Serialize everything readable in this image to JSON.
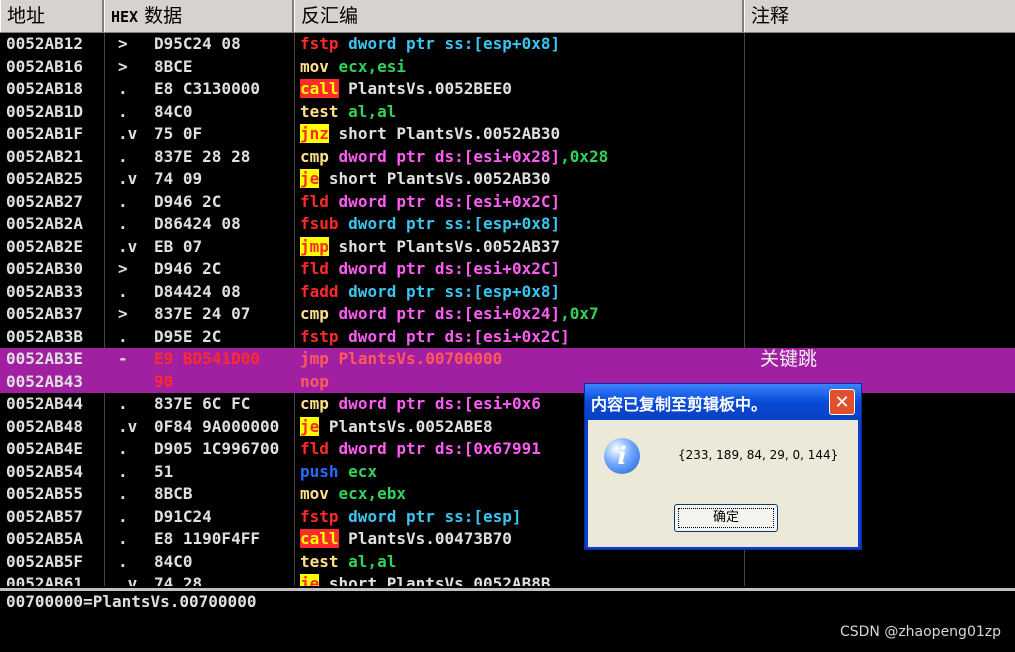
{
  "header": {
    "address": "地址",
    "hex_prefix": "HEX",
    "hex_label": "数据",
    "disasm": "反汇编",
    "comment": "注释"
  },
  "rows": [
    {
      "addr": "0052AB12",
      "mark": ">",
      "hex": "D95C24 08",
      "mn": "fstp",
      "mc": "m-fpu",
      "ops": [
        [
          "dword ptr ss:[esp+0x8]",
          "o1"
        ]
      ]
    },
    {
      "addr": "0052AB16",
      "mark": ">",
      "hex": "8BCE",
      "mn": "mov",
      "mc": "m-mov",
      "ops": [
        [
          "ecx,esi",
          "o4"
        ]
      ]
    },
    {
      "addr": "0052AB18",
      "mark": ".",
      "hex": "E8 C3130000",
      "mn": "call",
      "mc": "m-call",
      "ops": [
        [
          "PlantsVs.0052BEE0",
          "o3"
        ]
      ]
    },
    {
      "addr": "0052AB1D",
      "mark": ".",
      "hex": "84C0",
      "mn": "test",
      "mc": "m-test",
      "ops": [
        [
          "al,al",
          "o4"
        ]
      ]
    },
    {
      "addr": "0052AB1F",
      "mark": ".v",
      "hex": "75 0F",
      "mn": "jnz",
      "mc": "m-jcc",
      "ops": [
        [
          "short PlantsVs.0052AB30",
          "o3"
        ]
      ]
    },
    {
      "addr": "0052AB21",
      "mark": ".",
      "hex": "837E 28 28",
      "mn": "cmp",
      "mc": "m-mov",
      "ops": [
        [
          "dword ptr ds:[esi+0x28]",
          "o2"
        ],
        [
          ",0x28",
          "o4"
        ]
      ]
    },
    {
      "addr": "0052AB25",
      "mark": ".v",
      "hex": "74 09",
      "mn": "je",
      "mc": "m-jcc",
      "ops": [
        [
          "short PlantsVs.0052AB30",
          "o3"
        ]
      ]
    },
    {
      "addr": "0052AB27",
      "mark": ".",
      "hex": "D946 2C",
      "mn": "fld",
      "mc": "m-fpu",
      "ops": [
        [
          "dword ptr ds:[esi+0x2C]",
          "o2"
        ]
      ]
    },
    {
      "addr": "0052AB2A",
      "mark": ".",
      "hex": "D86424 08",
      "mn": "fsub",
      "mc": "m-fpu",
      "ops": [
        [
          "dword ptr ss:[esp+0x8]",
          "o1"
        ]
      ]
    },
    {
      "addr": "0052AB2E",
      "mark": ".v",
      "hex": "EB 07",
      "mn": "jmp",
      "mc": "m-jcc",
      "ops": [
        [
          "short PlantsVs.0052AB37",
          "o3"
        ]
      ]
    },
    {
      "addr": "0052AB30",
      "mark": ">",
      "hex": "D946 2C",
      "mn": "fld",
      "mc": "m-fpu",
      "ops": [
        [
          "dword ptr ds:[esi+0x2C]",
          "o2"
        ]
      ]
    },
    {
      "addr": "0052AB33",
      "mark": ".",
      "hex": "D84424 08",
      "mn": "fadd",
      "mc": "m-fpu",
      "ops": [
        [
          "dword ptr ss:[esp+0x8]",
          "o1"
        ]
      ]
    },
    {
      "addr": "0052AB37",
      "mark": ">",
      "hex": "837E 24 07",
      "mn": "cmp",
      "mc": "m-mov",
      "ops": [
        [
          "dword ptr ds:[esi+0x24]",
          "o2"
        ],
        [
          ",0x7",
          "o4"
        ]
      ]
    },
    {
      "addr": "0052AB3B",
      "mark": ".",
      "hex": "D95E 2C",
      "mn": "fstp",
      "mc": "m-fpu",
      "ops": [
        [
          "dword ptr ds:[esi+0x2C]",
          "o2"
        ]
      ]
    },
    {
      "addr": "0052AB3E",
      "mark": "-",
      "hex": "E9 BD541D00",
      "mn": "jmp",
      "mc": "m-jcc",
      "ops": [
        [
          "PlantsVs.00700000",
          "o3"
        ]
      ],
      "sel": true,
      "comment": "关键跳"
    },
    {
      "addr": "0052AB43",
      "mark": "",
      "hex": "90",
      "mn": "nop",
      "mc": "m-mov",
      "ops": [],
      "sel": true
    },
    {
      "addr": "0052AB44",
      "mark": ".",
      "hex": "837E 6C FC",
      "mn": "cmp",
      "mc": "m-mov",
      "ops": [
        [
          "dword ptr ds:[esi+0x6",
          "o2"
        ]
      ]
    },
    {
      "addr": "0052AB48",
      "mark": ".v",
      "hex": "0F84 9A000000",
      "mn": "je",
      "mc": "m-jcc",
      "ops": [
        [
          "PlantsVs.0052ABE8",
          "o3"
        ]
      ]
    },
    {
      "addr": "0052AB4E",
      "mark": ".",
      "hex": "D905 1C996700",
      "mn": "fld",
      "mc": "m-fpu",
      "ops": [
        [
          "dword ptr ds:[0x67991",
          "o2"
        ]
      ]
    },
    {
      "addr": "0052AB54",
      "mark": ".",
      "hex": "51",
      "mn": "push",
      "mc": "m-push",
      "ops": [
        [
          "ecx",
          "o4"
        ]
      ]
    },
    {
      "addr": "0052AB55",
      "mark": ".",
      "hex": "8BCB",
      "mn": "mov",
      "mc": "m-mov",
      "ops": [
        [
          "ecx,ebx",
          "o4"
        ]
      ]
    },
    {
      "addr": "0052AB57",
      "mark": ".",
      "hex": "D91C24",
      "mn": "fstp",
      "mc": "m-fpu",
      "ops": [
        [
          "dword ptr ss:[esp]",
          "o1"
        ]
      ]
    },
    {
      "addr": "0052AB5A",
      "mark": ".",
      "hex": "E8 1190F4FF",
      "mn": "call",
      "mc": "m-call",
      "ops": [
        [
          "PlantsVs.00473B70",
          "o3"
        ]
      ]
    },
    {
      "addr": "0052AB5F",
      "mark": ".",
      "hex": "84C0",
      "mn": "test",
      "mc": "m-test",
      "ops": [
        [
          "al,al",
          "o4"
        ]
      ]
    },
    {
      "addr": "0052AB61",
      "mark": ".v",
      "hex": "74 28",
      "mn": "je",
      "mc": "m-jcc",
      "ops": [
        [
          "short PlantsVs.0052AB8B",
          "o3"
        ]
      ]
    }
  ],
  "info_line": "00700000=PlantsVs.00700000",
  "watermark": "CSDN @zhaopeng01zp",
  "dialog": {
    "title": "内容已复制至剪辑板中。",
    "close": "✕",
    "icon": "i",
    "message": "{233, 189, 84, 29, 0, 144}",
    "ok": "确定"
  },
  "colors": {
    "selection": "#a11fa1",
    "dialog_title": "#0a4ad8"
  }
}
